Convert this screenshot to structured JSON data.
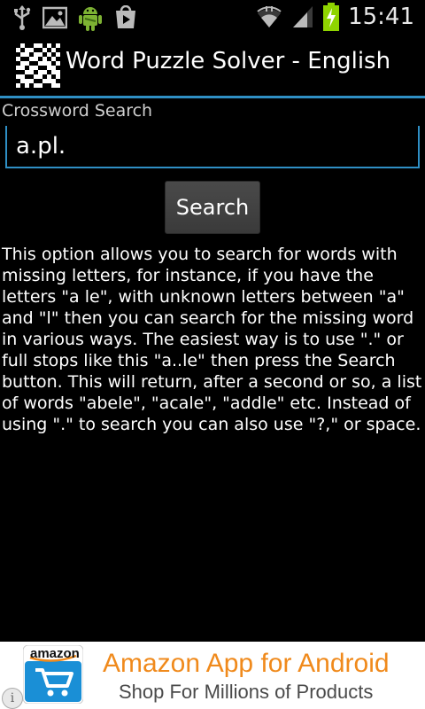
{
  "status_bar": {
    "time": "15:41",
    "left_icons": [
      "usb-icon",
      "gallery-icon",
      "android-icon",
      "play-store-icon"
    ],
    "right_icons": [
      "wifi-icon",
      "signal-icon",
      "battery-charging-icon"
    ]
  },
  "header": {
    "title": "Word Puzzle Solver - English",
    "icon": "qr-code-icon"
  },
  "form": {
    "label": "Crossword Search",
    "input_value": "a.pl.",
    "search_button_label": "Search"
  },
  "description": "This option allows you to search for words with missing letters, for instance, if you have the letters \"a le\", with unknown letters between \"a\" and \"l\" then you can search for the missing word in various ways. The easiest way is to use \".\" or full stops like this \"a..le\" then press the Search button. This will return, after a second or so, a list of words \"abele\", \"acale\", \"addle\" etc. Instead of using \".\" to search you can also use \"?,\" or space.",
  "ad": {
    "logo_text": "amazon",
    "title": "Amazon App for Android",
    "subtitle": "Shop For Millions of Products",
    "info_glyph": "i"
  },
  "colors": {
    "accent": "#2f8fc4",
    "ad_title": "#f08a1c",
    "battery": "#8fd400"
  }
}
